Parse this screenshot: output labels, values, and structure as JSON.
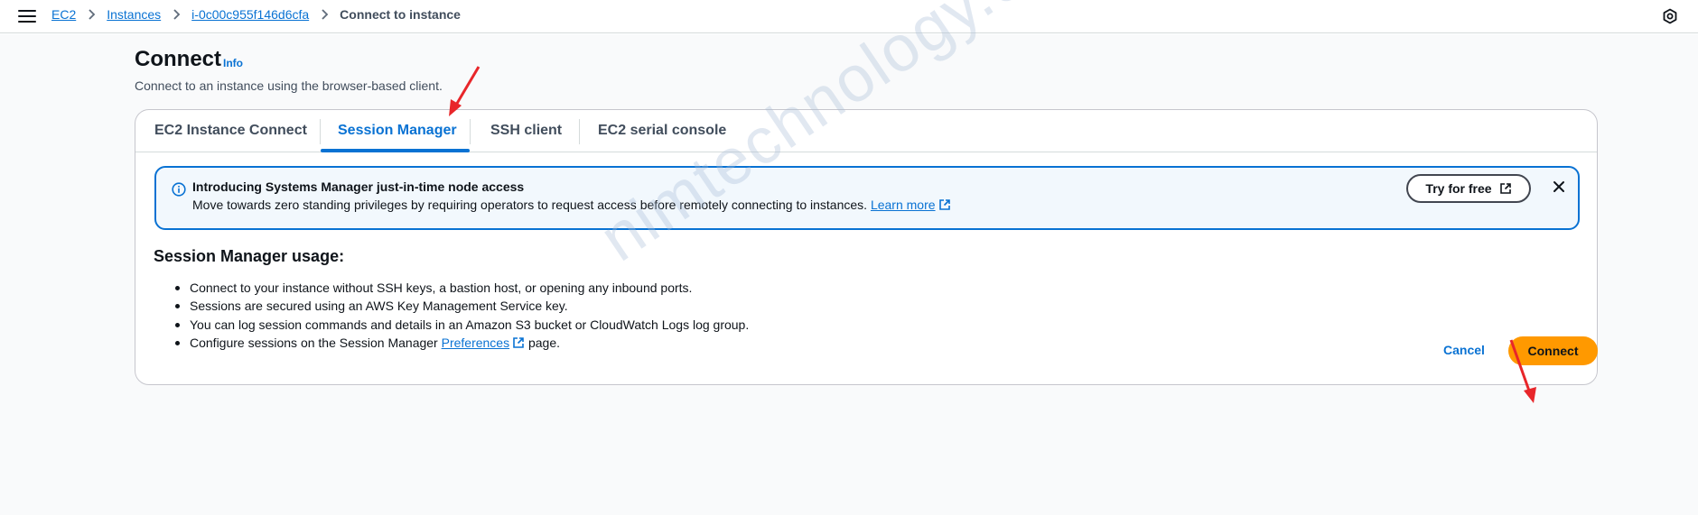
{
  "breadcrumb": {
    "items": [
      "EC2",
      "Instances",
      "i-0c00c955f146d6cfa"
    ],
    "current": "Connect to instance"
  },
  "page": {
    "title": "Connect",
    "info_label": "Info",
    "description": "Connect to an instance using the browser-based client."
  },
  "tabs": [
    {
      "label": "EC2 Instance Connect",
      "active": false
    },
    {
      "label": "Session Manager",
      "active": true
    },
    {
      "label": "SSH client",
      "active": false
    },
    {
      "label": "EC2 serial console",
      "active": false
    }
  ],
  "alert": {
    "title": "Introducing Systems Manager just-in-time node access",
    "text": "Move towards zero standing privileges by requiring operators to request access before remotely connecting to instances.",
    "link_label": "Learn more",
    "button_label": "Try for free"
  },
  "usage": {
    "title": "Session Manager usage:",
    "items": [
      "Connect to your instance without SSH keys, a bastion host, or opening any inbound ports.",
      "Sessions are secured using an AWS Key Management Service key.",
      "You can log session commands and details in an Amazon S3 bucket or CloudWatch Logs log group."
    ],
    "last_item": {
      "prefix": "Configure sessions on the Session Manager",
      "link": "Preferences",
      "suffix": "page."
    }
  },
  "actions": {
    "cancel_label": "Cancel",
    "connect_label": "Connect"
  },
  "watermark": "nimtechnology.com",
  "colors": {
    "accent": "#0972d3",
    "primary_button": "#ff9900",
    "alert_bg": "#f2f8fd",
    "annotation_arrow": "#e8262a"
  }
}
